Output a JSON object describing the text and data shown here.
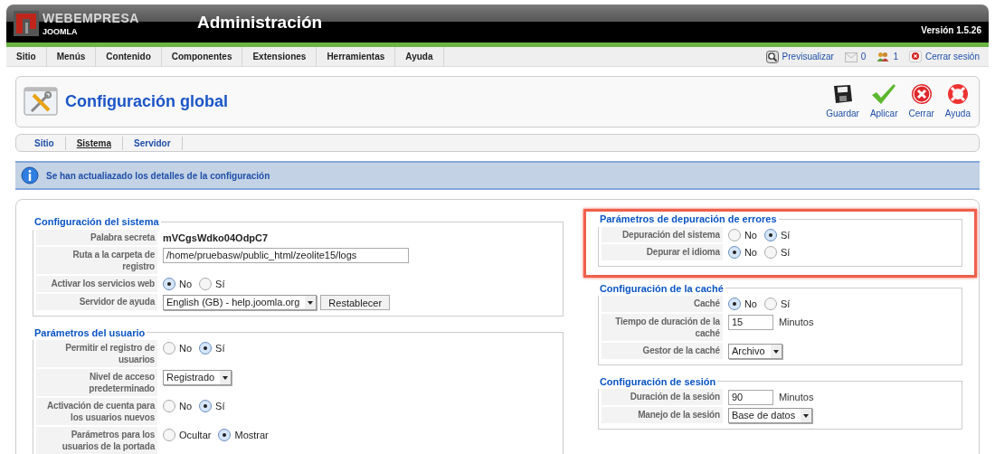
{
  "header": {
    "logo_top": "WEBEMPRESA",
    "logo_bottom": "JOOMLA",
    "title": "Administración",
    "version": "Versión 1.5.26"
  },
  "menu": [
    {
      "label": "Sitio"
    },
    {
      "label": "Menús"
    },
    {
      "label": "Contenido"
    },
    {
      "label": "Componentes"
    },
    {
      "label": "Extensiones"
    },
    {
      "label": "Herramientas"
    },
    {
      "label": "Ayuda"
    }
  ],
  "status": [
    {
      "kind": "preview",
      "label": "Previsualizar"
    },
    {
      "kind": "messages",
      "label": "0"
    },
    {
      "kind": "users",
      "label": "1"
    },
    {
      "kind": "logout",
      "label": "Cerrar sesión"
    }
  ],
  "toolbar": {
    "title": "Configuración global",
    "buttons": [
      {
        "kind": "save",
        "label": "Guardar"
      },
      {
        "kind": "apply",
        "label": "Aplicar"
      },
      {
        "kind": "close",
        "label": "Cerrar"
      },
      {
        "kind": "help",
        "label": "Ayuda"
      }
    ]
  },
  "subtabs": [
    {
      "label": "Sitio",
      "selected": false
    },
    {
      "label": "Sistema",
      "selected": true
    },
    {
      "label": "Servidor",
      "selected": false
    }
  ],
  "message": "Se han actualiazado los detalles de la configuración",
  "columns": [
    [
      {
        "legend": "Configuración del sistema",
        "highlighted": false,
        "rows": [
          {
            "label": "Palabra secreta",
            "kind": "text",
            "value": "mVCgsWdko04OdpC7"
          },
          {
            "label": "Ruta a la carpeta de registro",
            "kind": "input",
            "value": "/home/pruebasw/public_html/zeolite15/logs"
          },
          {
            "label": "Activar los servicios web",
            "kind": "radio",
            "options": [
              {
                "label": "No",
                "selected": true
              },
              {
                "label": "Sí",
                "selected": false
              }
            ]
          },
          {
            "label": "Servidor de ayuda",
            "kind": "select",
            "value": "English (GB) - help.joomla.org",
            "button": "Restablecer"
          }
        ]
      },
      {
        "legend": "Parámetros del usuario",
        "highlighted": false,
        "rows": [
          {
            "label": "Permitir el registro de usuarios",
            "kind": "radio",
            "options": [
              {
                "label": "No",
                "selected": false
              },
              {
                "label": "Sí",
                "selected": true
              }
            ]
          },
          {
            "label": "Nivel de acceso predeterminado",
            "kind": "select",
            "value": "Registrado"
          },
          {
            "label": "Activación de cuenta para los usuarios nuevos",
            "kind": "radio",
            "options": [
              {
                "label": "No",
                "selected": false
              },
              {
                "label": "Sí",
                "selected": true
              }
            ]
          },
          {
            "label": "Parámetros para los usuarios de la portada",
            "kind": "radio",
            "options": [
              {
                "label": "Ocultar",
                "selected": false
              },
              {
                "label": "Mostrar",
                "selected": true
              }
            ]
          }
        ]
      }
    ],
    [
      {
        "legend": "Parámetros de depuración de errores",
        "highlighted": true,
        "rows": [
          {
            "label": "Depuración del sistema",
            "kind": "radio",
            "options": [
              {
                "label": "No",
                "selected": false
              },
              {
                "label": "Sí",
                "selected": true
              }
            ]
          },
          {
            "label": "Depurar el idioma",
            "kind": "radio",
            "options": [
              {
                "label": "No",
                "selected": true
              },
              {
                "label": "Sí",
                "selected": false
              }
            ]
          }
        ]
      },
      {
        "legend": "Configuración de la caché",
        "highlighted": false,
        "rows": [
          {
            "label": "Caché",
            "kind": "radio",
            "options": [
              {
                "label": "No",
                "selected": true
              },
              {
                "label": "Sí",
                "selected": false
              }
            ]
          },
          {
            "label": "Tiempo de duración de la caché",
            "kind": "input",
            "value": "15",
            "unit": "Minutos"
          },
          {
            "label": "Gestor de la caché",
            "kind": "select",
            "value": "Archivo"
          }
        ]
      },
      {
        "legend": "Configuración de sesión",
        "highlighted": false,
        "rows": [
          {
            "label": "Duración de la sesión",
            "kind": "input",
            "value": "90",
            "unit": "Minutos"
          },
          {
            "label": "Manejo de la sesión",
            "kind": "select",
            "value": "Base de datos"
          }
        ]
      }
    ]
  ]
}
